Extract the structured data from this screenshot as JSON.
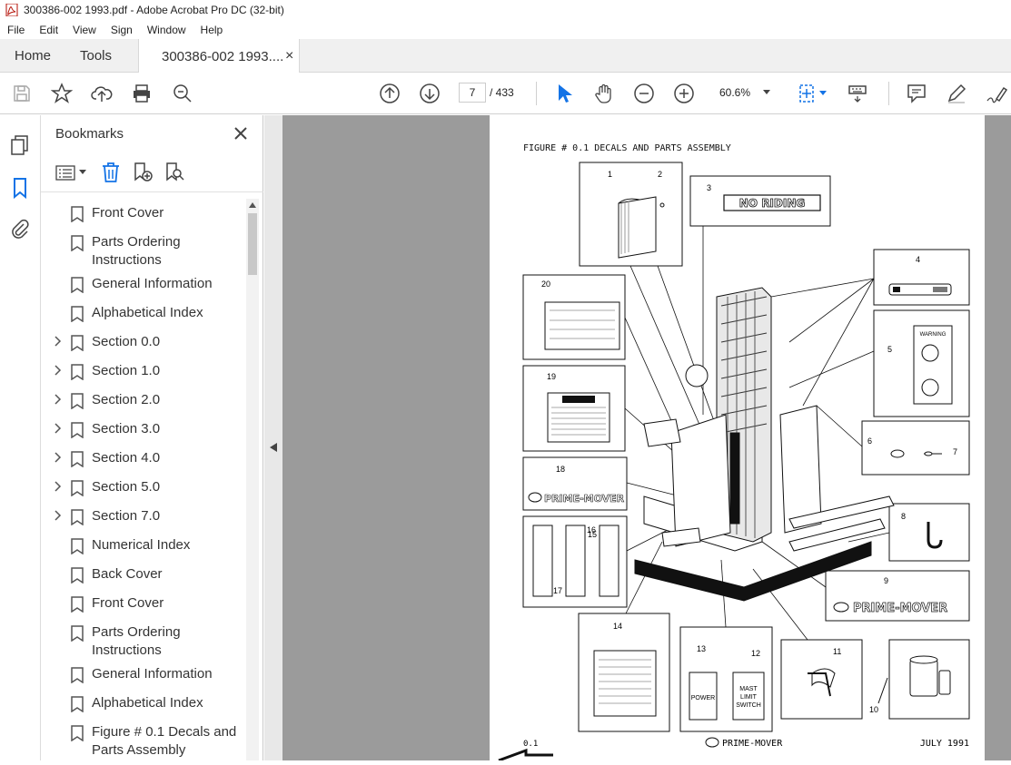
{
  "window": {
    "title": "300386-002 1993.pdf - Adobe Acrobat Pro DC (32-bit)"
  },
  "menu": [
    "File",
    "Edit",
    "View",
    "Sign",
    "Window",
    "Help"
  ],
  "tabs": {
    "home": "Home",
    "tools": "Tools",
    "doc": "300386-002 1993....",
    "close": "×"
  },
  "toolbar": {
    "page_current": "7",
    "page_total": "/ 433",
    "zoom": "60.6%"
  },
  "bookmarks": {
    "title": "Bookmarks",
    "items": [
      {
        "label": "Front Cover",
        "expandable": false
      },
      {
        "label": "Parts Ordering Instructions",
        "expandable": false
      },
      {
        "label": "General Information",
        "expandable": false
      },
      {
        "label": "Alphabetical Index",
        "expandable": false
      },
      {
        "label": "Section 0.0",
        "expandable": true
      },
      {
        "label": "Section 1.0",
        "expandable": true
      },
      {
        "label": "Section 2.0",
        "expandable": true
      },
      {
        "label": "Section 3.0",
        "expandable": true
      },
      {
        "label": "Section 4.0",
        "expandable": true
      },
      {
        "label": "Section 5.0",
        "expandable": true
      },
      {
        "label": "Section 7.0",
        "expandable": true
      },
      {
        "label": "Numerical Index",
        "expandable": false
      },
      {
        "label": "Back Cover",
        "expandable": false
      },
      {
        "label": "Front Cover",
        "expandable": false
      },
      {
        "label": "Parts Ordering Instructions",
        "expandable": false
      },
      {
        "label": "General Information",
        "expandable": false
      },
      {
        "label": "Alphabetical Index",
        "expandable": false
      },
      {
        "label": "Figure # 0.1 Decals and Parts Assembly",
        "expandable": false
      }
    ]
  },
  "document": {
    "figure_title": "FIGURE # 0.1 DECALS AND PARTS ASSEMBLY",
    "callouts": [
      "1",
      "2",
      "3",
      "4",
      "5",
      "6",
      "7",
      "8",
      "9",
      "10",
      "11",
      "12",
      "13",
      "14",
      "15",
      "16",
      "17",
      "18",
      "19",
      "20"
    ],
    "no_riding": "NO RIDING",
    "prime_mover": "PRIME-MOVER",
    "warning": "WARNING",
    "power": "POWER",
    "mast_limit_switch": [
      "MAST",
      "LIMIT",
      "SWITCH"
    ],
    "footer_left": "0.1",
    "footer_center": "PRIME-MOVER",
    "footer_right": "JULY 1991"
  }
}
